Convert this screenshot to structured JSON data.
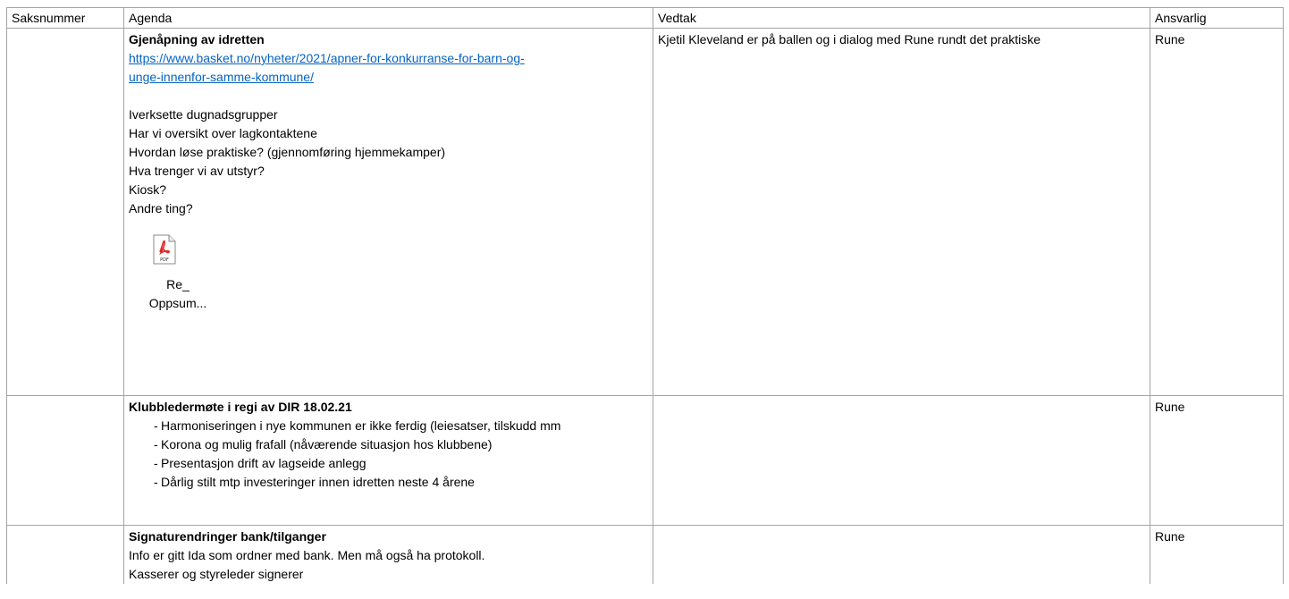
{
  "headers": [
    "Saksnummer",
    "Agenda",
    "Vedtak",
    "Ansvarlig"
  ],
  "rows": [
    {
      "title": "Gjenåpning av idretten",
      "link_line1": "https://www.basket.no/nyheter/2021/apner-for-konkurranse-for-barn-og-",
      "link_line2": "unge-innenfor-samme-kommune/",
      "lines": [
        "Iverksette dugnadsgrupper",
        "Har vi oversikt over lagkontaktene",
        "Hvordan løse praktiske? (gjennomføring hjemmekamper)",
        "Hva trenger vi av utstyr?",
        "Kiosk?",
        "Andre ting?"
      ],
      "attachment": {
        "icon": "pdf-file-icon",
        "icon_label": "PDF",
        "name_line1": "Re_",
        "name_line2": "Oppsum..."
      },
      "vedtak": "Kjetil Kleveland er på ballen og i dialog med Rune rundt det praktiske",
      "ansvarlig": "Rune"
    },
    {
      "title": "Klubbledermøte i regi av DIR 18.02.21",
      "bullets": [
        "Harmoniseringen i nye kommunen er ikke ferdig (leiesatser, tilskudd mm",
        "Korona og mulig frafall (nåværende situasjon hos klubbene)",
        "Presentasjon drift av lagseide anlegg",
        "Dårlig stilt mtp investeringer innen idretten neste 4 årene"
      ],
      "vedtak": "",
      "ansvarlig": "Rune"
    },
    {
      "title": "Signaturendringer bank/tilganger",
      "lines": [
        "Info er gitt Ida som ordner med bank. Men må også ha protokoll.",
        "Kasserer og styreleder signerer"
      ],
      "vedtak": "",
      "ansvarlig": "Rune"
    }
  ],
  "colors": {
    "link": "#0563c1",
    "border": "#a3a3a3",
    "pdf_red": "#e02424"
  }
}
